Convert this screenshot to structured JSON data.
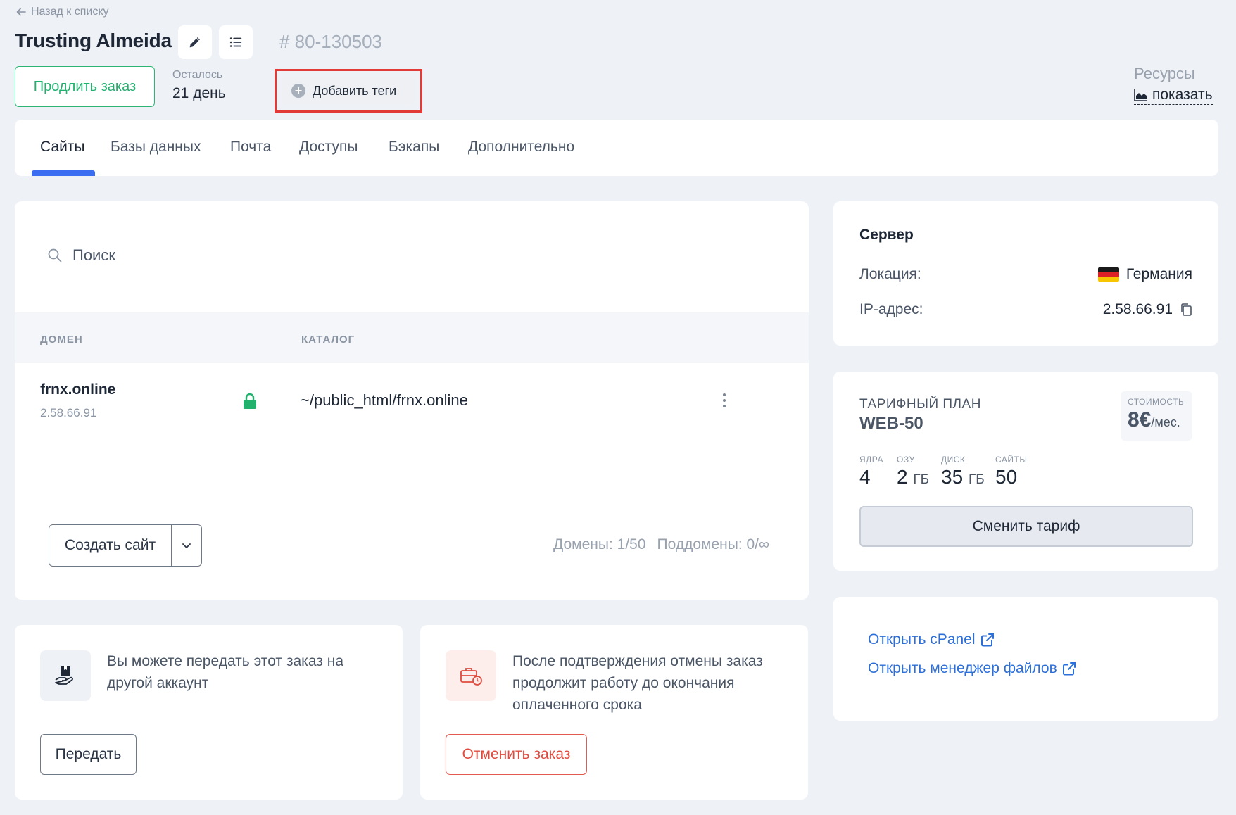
{
  "header": {
    "back_label": "Назад к списку",
    "title": "Trusting Almeida",
    "order_id": "# 80-130503",
    "extend_button": "Продлить заказ",
    "remaining_label": "Осталось",
    "remaining_value": "21 день",
    "add_tags_button": "Добавить теги",
    "resources_label": "Ресурсы",
    "resources_show": "показать"
  },
  "tabs": [
    {
      "label": "Сайты",
      "active": true
    },
    {
      "label": "Базы данных",
      "active": false
    },
    {
      "label": "Почта",
      "active": false
    },
    {
      "label": "Доступы",
      "active": false
    },
    {
      "label": "Бэкапы",
      "active": false
    },
    {
      "label": "Дополнительно",
      "active": false
    }
  ],
  "sites": {
    "search_placeholder": "Поиск",
    "columns": [
      "ДОМЕН",
      "КАТАЛОГ"
    ],
    "rows": [
      {
        "domain": "frnx.online",
        "ip": "2.58.66.91",
        "path": "~/public_html/frnx.online",
        "ssl": true
      }
    ],
    "create_button": "Создать сайт",
    "domains_count": "Домены: 1/50",
    "subdomains_count": "Поддомены: 0/∞"
  },
  "server": {
    "title": "Сервер",
    "location_label": "Локация:",
    "location_value": "Германия",
    "ip_label": "IP-адрес:",
    "ip_value": "2.58.66.91"
  },
  "plan": {
    "label": "ТАРИФНЫЙ ПЛАН",
    "name": "WEB-50",
    "price_label": "СТОИМОСТЬ",
    "price_value": "8€",
    "price_unit": "/мес.",
    "specs": [
      {
        "label": "ЯДРА",
        "value": "4",
        "unit": ""
      },
      {
        "label": "ОЗУ",
        "value": "2",
        "unit": "ГБ"
      },
      {
        "label": "ДИСК",
        "value": "35",
        "unit": "ГБ"
      },
      {
        "label": "САЙТЫ",
        "value": "50",
        "unit": ""
      }
    ],
    "change_button": "Сменить тариф"
  },
  "links": {
    "cpanel": "Открыть cPanel",
    "file_manager": "Открыть менеджер файлов"
  },
  "transfer": {
    "text": "Вы можете передать этот заказ на другой аккаунт",
    "button": "Передать"
  },
  "cancel": {
    "text": "После подтверждения отмены заказ продолжит работу до окончания оплаченного срока",
    "button": "Отменить заказ"
  },
  "colors": {
    "accent": "#3a6df0",
    "success": "#22b06d",
    "danger": "#e04b3e",
    "link": "#2c6fd8",
    "highlight": "#e23a36"
  },
  "icons": {
    "back": "arrow-left-icon",
    "edit": "pencil-icon",
    "list": "list-icon",
    "add_tag": "plus-circle-icon",
    "resources": "area-chart-icon",
    "search": "search-icon",
    "ssl": "lock-icon",
    "row_menu": "kebab-menu-icon",
    "dropdown": "chevron-down-icon",
    "copy": "copy-icon",
    "external": "external-link-icon",
    "transfer": "hand-box-icon",
    "cancel": "briefcase-clock-icon",
    "flag": "germany-flag-icon"
  }
}
